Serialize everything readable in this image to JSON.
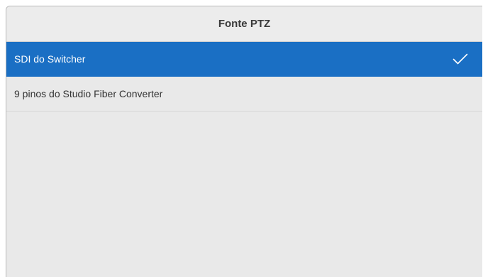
{
  "header": {
    "title": "Fonte PTZ"
  },
  "options": [
    {
      "label": "SDI do Switcher",
      "selected": true,
      "icon": "checkmark-icon"
    },
    {
      "label": "9 pinos do Studio Fiber Converter",
      "selected": false
    }
  ],
  "colors": {
    "selected_bg": "#1a6fc4",
    "panel_bg": "#e9e9e9",
    "text": "#333333"
  }
}
